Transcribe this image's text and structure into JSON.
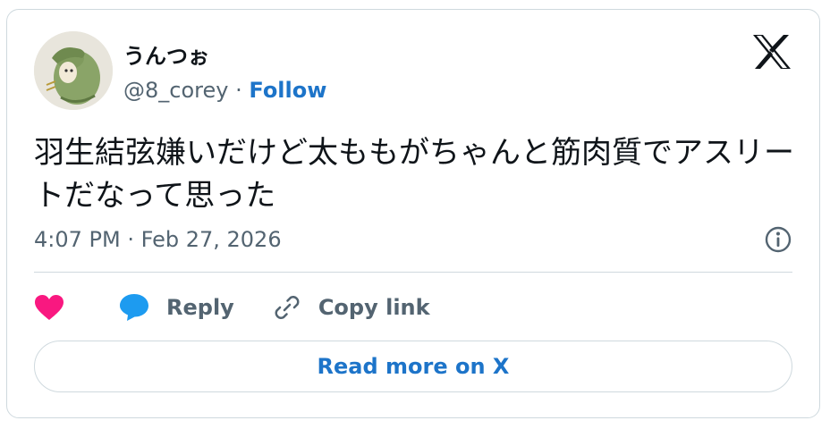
{
  "author": {
    "display_name": "うんつぉ",
    "handle": "@8_corey",
    "separator": "·",
    "follow_label": "Follow"
  },
  "tweet": {
    "text": "羽生結弦嫌いだけど太ももがちゃんと筋肉質でアスリートだなって思った",
    "timestamp": "4:07 PM · Feb 27, 2026"
  },
  "actions": {
    "reply_label": "Reply",
    "copy_link_label": "Copy link"
  },
  "read_more_label": "Read more on X",
  "colors": {
    "like": "#f91880",
    "reply": "#1d9bf0",
    "link": "#1d74c9",
    "secondary_text": "#536471",
    "border": "#cfd9de"
  },
  "icons": {
    "brand": "x-logo-icon",
    "info": "info-icon",
    "like": "heart-icon",
    "reply": "speech-bubble-icon",
    "copy": "link-icon"
  }
}
